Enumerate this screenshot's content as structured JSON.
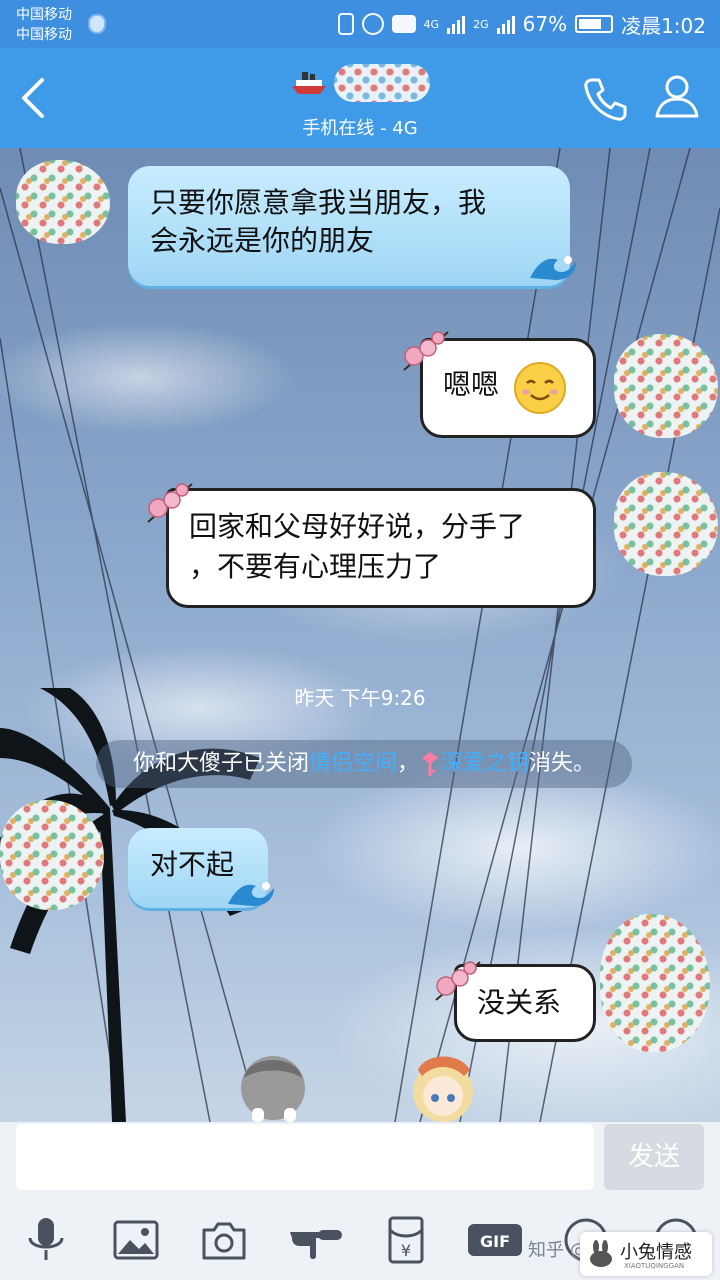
{
  "status_bar": {
    "carrier_1": "中国移动",
    "carrier_2": "中国移动",
    "network_1": "4G",
    "network_2": "2G",
    "battery": "67%",
    "time": "凌晨1:02",
    "icons": [
      "shield-icon",
      "vibrate-icon",
      "alarm-icon",
      "hd-icon",
      "signal-icon",
      "battery-icon"
    ]
  },
  "header": {
    "subtitle": "手机在线 - 4G",
    "back_icon": "chevron-left-icon",
    "call_icon": "phone-icon",
    "profile_icon": "user-icon"
  },
  "messages": [
    {
      "side": "left",
      "style": "blue",
      "lines": [
        "只要你愿意拿我当朋友，我",
        "会永远是你的朋友"
      ]
    },
    {
      "side": "right",
      "style": "white",
      "lines": [
        "嗯嗯"
      ],
      "emoji": "smile-emoji"
    },
    {
      "side": "right",
      "style": "white",
      "lines": [
        "回家和父母好好说，分手了",
        "，不要有心理压力了"
      ]
    },
    {
      "side": "left",
      "style": "blue",
      "lines": [
        "对不起"
      ]
    },
    {
      "side": "right",
      "style": "white",
      "lines": [
        "没关系"
      ]
    }
  ],
  "time_separator": "昨天 下午9:26",
  "system_notice": {
    "prefix": "你和大傻子已关闭",
    "link_1": "情侣空间",
    "comma": "，",
    "link_2": "深爱之钥",
    "suffix": "消失。"
  },
  "composer": {
    "placeholder": "",
    "send_label": "发送"
  },
  "toolbar": [
    "microphone-icon",
    "image-icon",
    "camera-icon",
    "pointing-hand-icon",
    "red-packet-icon",
    "gif-icon",
    "emoji-icon",
    "more-icon"
  ],
  "watermark": "知乎 @",
  "logo": {
    "title": "小兔情感",
    "subtitle": "XIAOTUQINGGAN"
  },
  "colors": {
    "header": "#3f9be8",
    "status_bar": "#3f8fe0",
    "link": "#3fb1ff",
    "send_disabled": "#d6dbe2"
  }
}
